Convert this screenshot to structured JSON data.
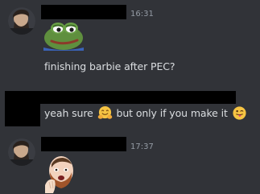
{
  "messages": [
    {
      "timestamp": "16:31",
      "sticker": "pepe-frog-sticker",
      "text": "finishing barbie after PEC?"
    },
    {
      "text_part1": "yeah sure",
      "emoji1": "hugging-face-emoji",
      "text_part2": "but only if you make it",
      "emoji2": "tongue-out-face-emoji"
    },
    {
      "timestamp": "17:37",
      "sticker": "streamer-face-sticker"
    }
  ],
  "colors": {
    "background": "#313338",
    "text": "#dbdee1",
    "timestamp": "#949ba4",
    "redaction": "#000000"
  }
}
